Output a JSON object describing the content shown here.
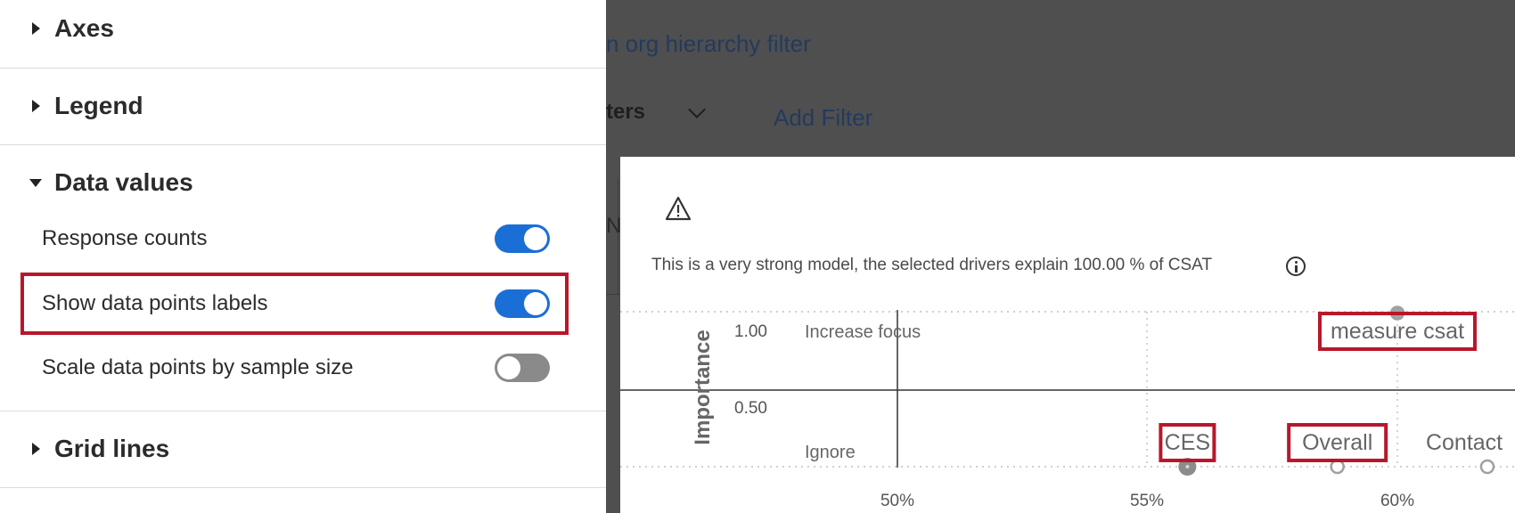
{
  "panel": {
    "sections": [
      {
        "title": "Axes",
        "expanded": false
      },
      {
        "title": "Legend",
        "expanded": false
      },
      {
        "title": "Data values",
        "expanded": true
      },
      {
        "title": "Grid lines",
        "expanded": false
      }
    ],
    "data_values": {
      "options": [
        {
          "label": "Response counts",
          "on": true
        },
        {
          "label": "Show data points labels",
          "on": true
        },
        {
          "label": "Scale data points by sample size",
          "on": false
        }
      ]
    }
  },
  "dashboard": {
    "filter_link": "n org hierarchy filter",
    "filters_label": "ters",
    "add_filter": "Add Filter",
    "tab_fragment": "N"
  },
  "card": {
    "warning_icon": "warning-icon",
    "model_text": "This is a very strong model, the selected drivers explain 100.00 % of CSAT",
    "info_icon": "info-icon"
  },
  "chart_data": {
    "type": "scatter",
    "ylabel": "Importance",
    "y_ticks": [
      "1.00",
      "0.50"
    ],
    "x_ticks": [
      "50%",
      "55%",
      "60%"
    ],
    "quadrant_labels": [
      "Increase focus",
      "Ignore"
    ],
    "points": [
      {
        "label": "measure csat",
        "x": 60,
        "y": 1.12,
        "highlighted": true
      },
      {
        "label": "CES",
        "x": 55.8,
        "y": 0.0,
        "highlighted": true
      },
      {
        "label": "Overall",
        "x": 58.8,
        "y": 0.0,
        "highlighted": true
      },
      {
        "label": "Contact",
        "x": 61.8,
        "y": 0.0,
        "highlighted": false
      }
    ],
    "colors": {
      "highlight": "#b8172b",
      "toggle_on": "#1a6fd6"
    }
  }
}
